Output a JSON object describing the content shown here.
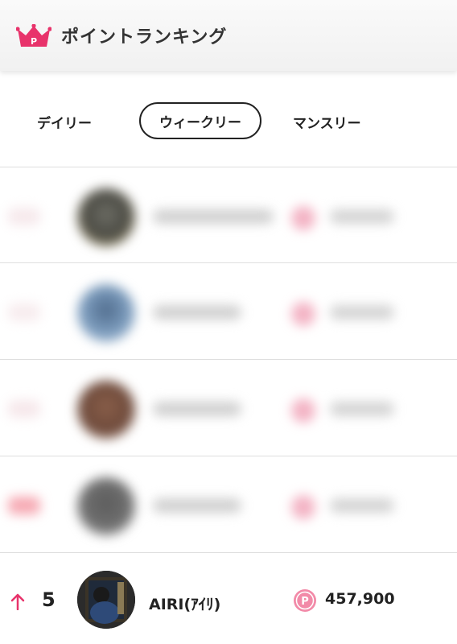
{
  "header": {
    "title": "ポイントランキング",
    "icon": "crown-icon",
    "icon_color": "#e8336b"
  },
  "tabs": [
    {
      "label": "デイリー",
      "selected": false
    },
    {
      "label": "ウィークリー",
      "selected": true
    },
    {
      "label": "マンスリー",
      "selected": false
    }
  ],
  "ranking": {
    "visible_entry": {
      "rank": "5",
      "trend": "up",
      "trend_color": "#e8336b",
      "name": "AIRI(ｱｲﾘ)",
      "points": "457,900",
      "point_icon": "point-coin-icon",
      "point_icon_color": "#f28aa8"
    }
  }
}
